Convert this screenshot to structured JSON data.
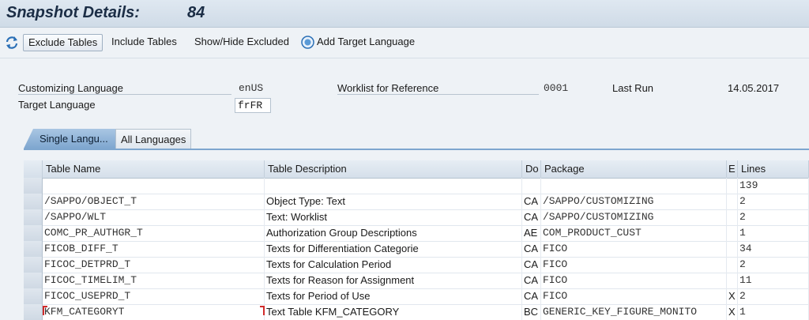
{
  "header": {
    "title": "Snapshot Details:",
    "snapshot_number": "84"
  },
  "toolbar": {
    "exclude_tables": "Exclude Tables",
    "include_tables": "Include Tables",
    "show_hide_excluded": "Show/Hide Excluded",
    "add_target_language": "Add Target Language"
  },
  "form": {
    "customizing_language_label": "Customizing Language",
    "customizing_language_value": "enUS",
    "target_language_label": "Target Language",
    "target_language_value": "frFR",
    "worklist_label": "Worklist for Reference",
    "worklist_value": "0001",
    "last_run_label": "Last Run",
    "last_run_value": "14.05.2017"
  },
  "tabs": [
    "Single Langu...",
    "All Languages"
  ],
  "table": {
    "columns": [
      "Table Name",
      "Table Description",
      "Do",
      "Package",
      "E",
      "Lines"
    ],
    "total_lines": "139",
    "rows": [
      {
        "name": "/SAPPO/OBJECT_T",
        "desc": "Object Type: Text",
        "do": "CA",
        "pkg": "/SAPPO/CUSTOMIZING",
        "e": "",
        "lines": "2"
      },
      {
        "name": "/SAPPO/WLT",
        "desc": "Text: Worklist",
        "do": "CA",
        "pkg": "/SAPPO/CUSTOMIZING",
        "e": "",
        "lines": "2"
      },
      {
        "name": "COMC_PR_AUTHGR_T",
        "desc": "Authorization Group Descriptions",
        "do": "AE",
        "pkg": "COM_PRODUCT_CUST",
        "e": "",
        "lines": "1"
      },
      {
        "name": "FICOB_DIFF_T",
        "desc": "Texts for Differentiation Categorie",
        "do": "CA",
        "pkg": "FICO",
        "e": "",
        "lines": "34"
      },
      {
        "name": "FICOC_DETPRD_T",
        "desc": "Texts for Calculation Period",
        "do": "CA",
        "pkg": "FICO",
        "e": "",
        "lines": "2"
      },
      {
        "name": "FICOC_TIMELIM_T",
        "desc": "Texts for Reason for Assignment",
        "do": "CA",
        "pkg": "FICO",
        "e": "",
        "lines": "11"
      },
      {
        "name": "FICOC_USEPRD_T",
        "desc": "Texts for Period of Use",
        "do": "CA",
        "pkg": "FICO",
        "e": "X",
        "lines": "2"
      },
      {
        "name": "KFM_CATEGORYT",
        "desc": "Text Table KFM_CATEGORY",
        "do": "BC",
        "pkg": "GENERIC_KEY_FIGURE_MONITO",
        "e": "X",
        "lines": "1"
      }
    ]
  }
}
